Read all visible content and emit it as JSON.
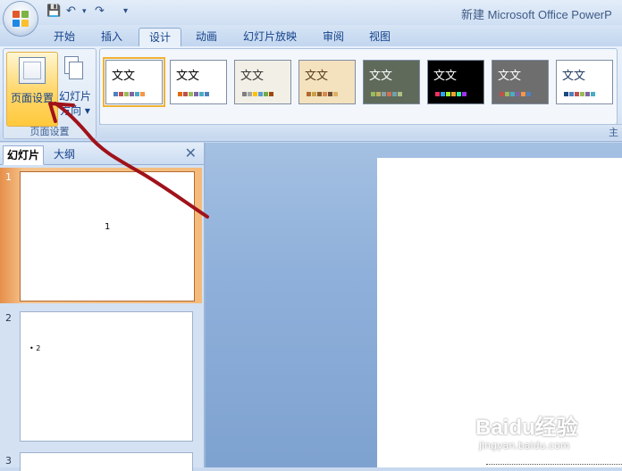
{
  "app": {
    "title": "新建 Microsoft Office PowerP"
  },
  "quick_access": {
    "save_glyph": "💾",
    "undo_glyph": "↶",
    "redo_glyph": "↷",
    "customize_glyph": "▾"
  },
  "ribbon_tabs": [
    {
      "label": "开始"
    },
    {
      "label": "插入"
    },
    {
      "label": "设计"
    },
    {
      "label": "动画"
    },
    {
      "label": "幻灯片放映"
    },
    {
      "label": "审阅"
    },
    {
      "label": "视图"
    }
  ],
  "active_tab": "设计",
  "page_setup_group": {
    "page_setup_label": "页面设置",
    "orientation_label_line1": "幻灯片",
    "orientation_label_line2": "方向 ▾",
    "group_label": "页面设置"
  },
  "themes": {
    "sample_text": "文文",
    "sample_text_alt": "文文",
    "group_label_fragment": "主",
    "items": [
      {
        "name": "office-theme",
        "bg": "#ffffff",
        "fg": "#000000",
        "swatches": [
          "#4f81bd",
          "#c0504d",
          "#9bbb59",
          "#8064a2",
          "#4bacc6",
          "#f79646"
        ]
      },
      {
        "name": "theme-2",
        "bg": "#ffffff",
        "fg": "#000000",
        "swatches": [
          "#e36c09",
          "#c0504d",
          "#9bbb59",
          "#8064a2",
          "#4bacc6",
          "#4f81bd"
        ]
      },
      {
        "name": "theme-3",
        "bg": "#f2f0e6",
        "fg": "#333333",
        "swatches": [
          "#7f7f7f",
          "#a5a5a5",
          "#ffc000",
          "#5b9bd5",
          "#70ad47",
          "#9e480e"
        ]
      },
      {
        "name": "theme-4",
        "bg": "#f3e2bd",
        "fg": "#5a3b1a",
        "swatches": [
          "#b46a2e",
          "#c8a24a",
          "#8b5a2b",
          "#d9884e",
          "#6f4e37",
          "#e0b060"
        ]
      },
      {
        "name": "theme-5",
        "bg": "#5f6a5b",
        "fg": "#ffffff",
        "swatches": [
          "#9bbb59",
          "#c0b060",
          "#8aa0a8",
          "#d07050",
          "#70a0b0",
          "#b0c080"
        ]
      },
      {
        "name": "theme-6",
        "bg": "#000000",
        "fg": "#ffffff",
        "swatches": [
          "#f03060",
          "#30a0f0",
          "#a0f030",
          "#f0a030",
          "#30f0a0",
          "#a030f0"
        ]
      },
      {
        "name": "theme-7",
        "bg": "#6e6e6e",
        "fg": "#ffffff",
        "swatches": [
          "#c0504d",
          "#9bbb59",
          "#4bacc6",
          "#8064a2",
          "#f79646",
          "#4f81bd"
        ]
      },
      {
        "name": "theme-8",
        "bg": "#ffffff",
        "fg": "#1f3a5f",
        "swatches": [
          "#1f497d",
          "#4f81bd",
          "#c0504d",
          "#9bbb59",
          "#8064a2",
          "#4bacc6"
        ]
      }
    ]
  },
  "slides_panel": {
    "tab_slides": "幻灯片",
    "tab_outline": "大纲",
    "close_glyph": "✕",
    "slides": [
      {
        "number": "1",
        "content": "1"
      },
      {
        "number": "2",
        "content": "• 2"
      },
      {
        "number": "3",
        "content": ""
      }
    ]
  },
  "watermark": {
    "text": "Baidu经验",
    "subtext": "jingyan.baidu.com"
  },
  "colors": {
    "ribbon_text": "#15428b",
    "annotation_red": "#a0121a",
    "selected_slide": "#f4bb7c"
  }
}
